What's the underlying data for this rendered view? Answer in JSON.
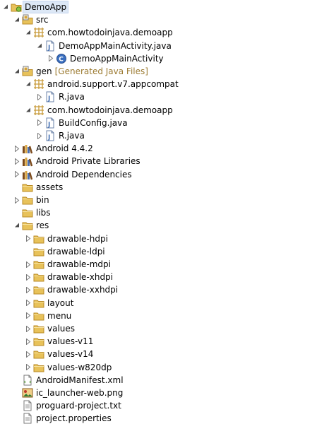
{
  "tree": {
    "items": [
      {
        "label": "DemoApp",
        "level": 0,
        "icon": "project-icon",
        "twisty": "open",
        "selected": true
      },
      {
        "label": "src",
        "level": 1,
        "icon": "source-folder-icon",
        "twisty": "open"
      },
      {
        "label": "com.howtodoinjava.demoapp",
        "level": 2,
        "icon": "package-icon",
        "twisty": "open"
      },
      {
        "label": "DemoAppMainActivity.java",
        "level": 3,
        "icon": "java-file-icon",
        "twisty": "open"
      },
      {
        "label": "DemoAppMainActivity",
        "level": 4,
        "icon": "class-icon",
        "twisty": "closed"
      },
      {
        "label": "gen",
        "decoration": "[Generated Java Files]",
        "level": 1,
        "icon": "source-folder-icon",
        "twisty": "open"
      },
      {
        "label": "android.support.v7.appcompat",
        "level": 2,
        "icon": "package-icon",
        "twisty": "open"
      },
      {
        "label": "R.java",
        "level": 3,
        "icon": "java-file-icon",
        "twisty": "closed"
      },
      {
        "label": "com.howtodoinjava.demoapp",
        "level": 2,
        "icon": "package-icon",
        "twisty": "open"
      },
      {
        "label": "BuildConfig.java",
        "level": 3,
        "icon": "java-file-icon",
        "twisty": "closed"
      },
      {
        "label": "R.java",
        "level": 3,
        "icon": "java-file-icon",
        "twisty": "closed"
      },
      {
        "label": "Android 4.4.2",
        "level": 1,
        "icon": "library-icon",
        "twisty": "closed"
      },
      {
        "label": "Android Private Libraries",
        "level": 1,
        "icon": "library-icon",
        "twisty": "closed"
      },
      {
        "label": "Android Dependencies",
        "level": 1,
        "icon": "library-icon",
        "twisty": "closed"
      },
      {
        "label": "assets",
        "level": 1,
        "icon": "folder-icon",
        "twisty": "none"
      },
      {
        "label": "bin",
        "level": 1,
        "icon": "folder-icon",
        "twisty": "closed"
      },
      {
        "label": "libs",
        "level": 1,
        "icon": "folder-icon",
        "twisty": "none"
      },
      {
        "label": "res",
        "level": 1,
        "icon": "folder-icon",
        "twisty": "open"
      },
      {
        "label": "drawable-hdpi",
        "level": 2,
        "icon": "folder-icon",
        "twisty": "closed"
      },
      {
        "label": "drawable-ldpi",
        "level": 2,
        "icon": "folder-icon",
        "twisty": "none"
      },
      {
        "label": "drawable-mdpi",
        "level": 2,
        "icon": "folder-icon",
        "twisty": "closed"
      },
      {
        "label": "drawable-xhdpi",
        "level": 2,
        "icon": "folder-icon",
        "twisty": "closed"
      },
      {
        "label": "drawable-xxhdpi",
        "level": 2,
        "icon": "folder-icon",
        "twisty": "closed"
      },
      {
        "label": "layout",
        "level": 2,
        "icon": "folder-icon",
        "twisty": "closed"
      },
      {
        "label": "menu",
        "level": 2,
        "icon": "folder-icon",
        "twisty": "closed"
      },
      {
        "label": "values",
        "level": 2,
        "icon": "folder-icon",
        "twisty": "closed"
      },
      {
        "label": "values-v11",
        "level": 2,
        "icon": "folder-icon",
        "twisty": "closed"
      },
      {
        "label": "values-v14",
        "level": 2,
        "icon": "folder-icon",
        "twisty": "closed"
      },
      {
        "label": "values-w820dp",
        "level": 2,
        "icon": "folder-icon",
        "twisty": "closed"
      },
      {
        "label": "AndroidManifest.xml",
        "level": 1,
        "icon": "xml-file-icon",
        "twisty": "none"
      },
      {
        "label": "ic_launcher-web.png",
        "level": 1,
        "icon": "image-file-icon",
        "twisty": "none"
      },
      {
        "label": "proguard-project.txt",
        "level": 1,
        "icon": "text-file-icon",
        "twisty": "none"
      },
      {
        "label": "project.properties",
        "level": 1,
        "icon": "text-file-icon",
        "twisty": "none"
      }
    ]
  },
  "colors": {
    "folder": "#e8c25a",
    "folder_dark": "#b98a25",
    "package": "#c89b3a",
    "java": "#4a74b5",
    "class": "#3a6fbf",
    "decoration": "#9b7a30",
    "selection": "#dde8f6"
  }
}
